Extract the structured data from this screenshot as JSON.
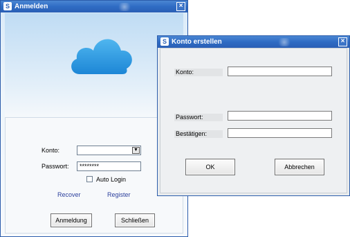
{
  "login": {
    "title": "Anmelden",
    "account_label": "Konto:",
    "account_value": "",
    "password_label": "Passwort:",
    "password_value": "********",
    "auto_login_label": "Auto Login",
    "recover_link": "Recover",
    "register_link": "Register",
    "login_button": "Anmeldung",
    "close_button": "Schließen"
  },
  "create": {
    "title": "Konto erstellen",
    "account_label": "Konto:",
    "password_label": "Passwort:",
    "confirm_label": "Bestätigen:",
    "ok_button": "OK",
    "cancel_button": "Abbrechen"
  },
  "icons": {
    "app": "app-icon",
    "close": "close-icon",
    "cloud": "cloud-logo"
  },
  "colors": {
    "titlebar": "#2f6cc4",
    "link": "#2b3f9c",
    "cloud": "#2e9be0"
  }
}
